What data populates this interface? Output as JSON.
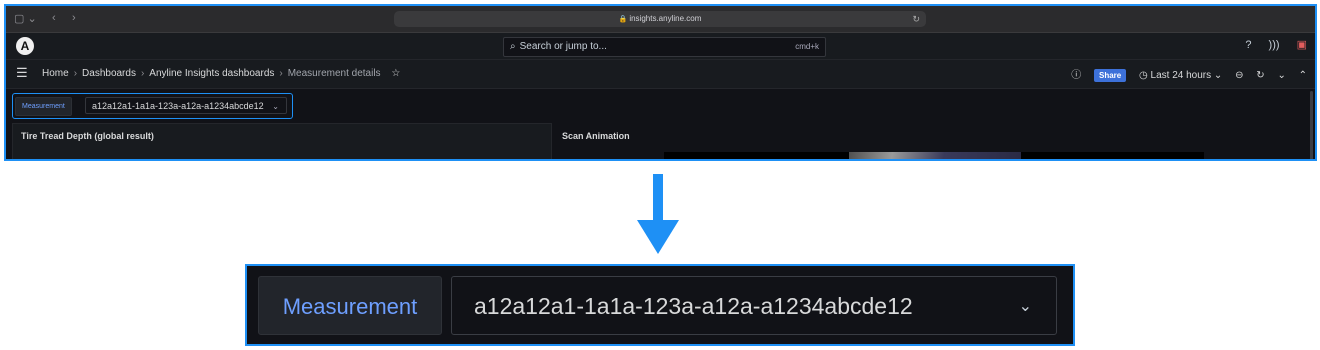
{
  "browser": {
    "url": "insights.anyline.com",
    "controls": [
      "▢ ⌄",
      "‹",
      "›"
    ]
  },
  "topbar": {
    "logo": "A",
    "search_placeholder": "Search or jump to...",
    "search_shortcut": "cmd+k"
  },
  "breadcrumb": {
    "items": [
      "Home",
      "Dashboards",
      "Anyline Insights dashboards"
    ],
    "current": "Measurement details",
    "separator": "›"
  },
  "nav_right": {
    "share_label": "Share",
    "time_range": "Last 24 hours"
  },
  "variable": {
    "label": "Measurement",
    "value": "a12a12a1-1a1a-123a-a12a-a1234abcde12"
  },
  "panels": {
    "left_title": "Tire Tread Depth (global result)",
    "right_title": "Scan Animation"
  },
  "zoom": {
    "label": "Measurement",
    "value": "a12a12a1-1a1a-123a-a12a-a1234abcde12"
  },
  "colors": {
    "highlight": "#1e90f5",
    "background": "#111217",
    "label_text": "#6e9fff"
  }
}
